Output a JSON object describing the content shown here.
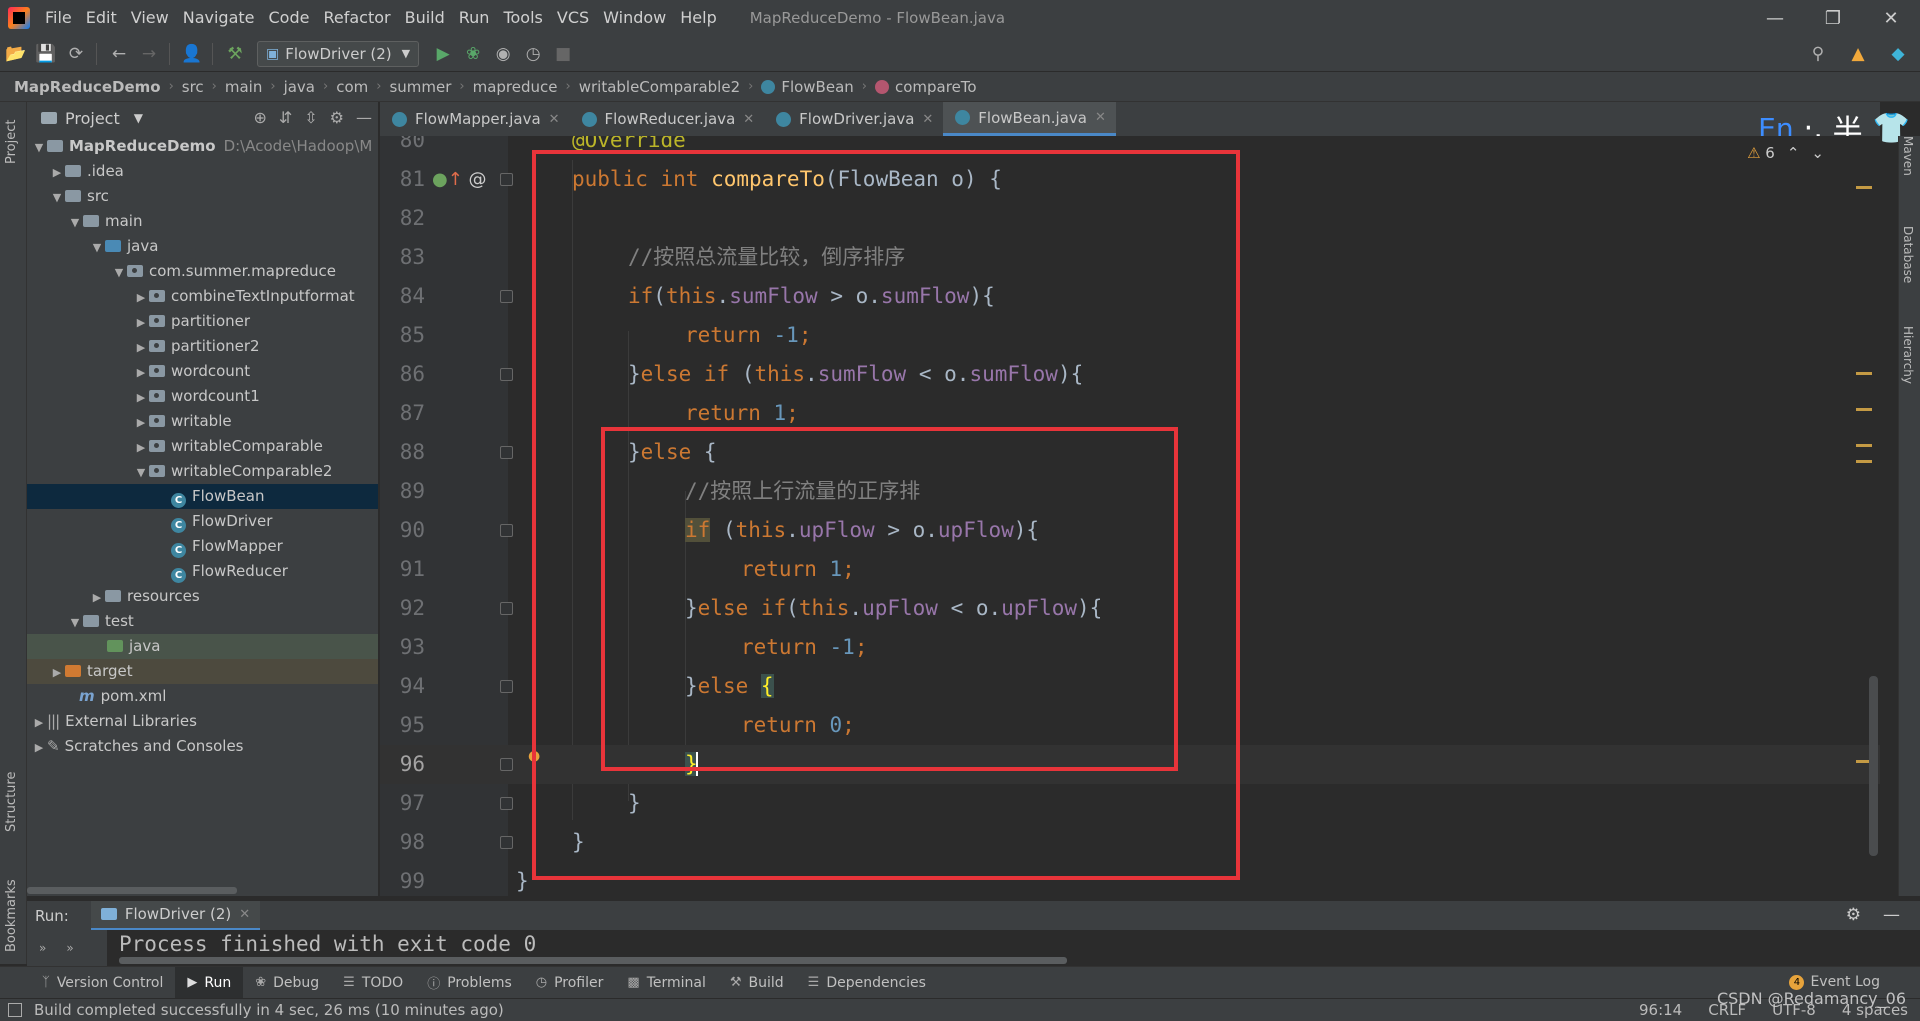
{
  "window": {
    "title": "MapReduceDemo - FlowBean.java",
    "menu": [
      "File",
      "Edit",
      "View",
      "Navigate",
      "Code",
      "Refactor",
      "Build",
      "Run",
      "Tools",
      "VCS",
      "Window",
      "Help"
    ]
  },
  "toolbar": {
    "run_config": "FlowDriver (2)"
  },
  "breadcrumb": [
    "MapReduceDemo",
    "src",
    "main",
    "java",
    "com",
    "summer",
    "mapreduce",
    "writableComparable2",
    "FlowBean",
    "compareTo"
  ],
  "project_panel": {
    "title": "Project",
    "root_name": "MapReduceDemo",
    "root_path": "D:\\Acode\\Hadoop\\M",
    "items": {
      "idea": ".idea",
      "src": "src",
      "main": "main",
      "java": "java",
      "pkg": "com.summer.mapreduce",
      "p1": "combineTextInputformat",
      "p2": "partitioner",
      "p3": "partitioner2",
      "p4": "wordcount",
      "p5": "wordcount1",
      "p6": "writable",
      "p7": "writableComparable",
      "p8": "writableComparable2",
      "c1": "FlowBean",
      "c2": "FlowDriver",
      "c3": "FlowMapper",
      "c4": "FlowReducer",
      "resources": "resources",
      "test": "test",
      "test_java": "java",
      "target": "target",
      "pom": "pom.xml",
      "libs": "External Libraries",
      "scratches": "Scratches and Consoles"
    }
  },
  "tabs": [
    {
      "label": "FlowMapper.java",
      "active": false
    },
    {
      "label": "FlowReducer.java",
      "active": false
    },
    {
      "label": "FlowDriver.java",
      "active": false
    },
    {
      "label": "FlowBean.java",
      "active": true
    }
  ],
  "ime": {
    "lang": "En",
    "punct": "·,",
    "width": "半"
  },
  "editor": {
    "warnings": "6",
    "line_numbers": [
      "80",
      "81",
      "82",
      "83",
      "84",
      "85",
      "86",
      "87",
      "88",
      "89",
      "90",
      "91",
      "92",
      "93",
      "94",
      "95",
      "96",
      "97",
      "98",
      "99"
    ],
    "current_line": "96",
    "code": {
      "l80": "@Override",
      "l81_kw": "public int ",
      "l81_fn": "compareTo",
      "l81_rest": "(FlowBean o) {",
      "l83": "//按照总流量比较，倒序排序",
      "l84_kw1": "if",
      "l84_p1": "(",
      "l84_kw2": "this",
      "l84_p2": ".",
      "l84_f1": "sumFlow",
      "l84_p3": " > o.",
      "l84_f2": "sumFlow",
      "l84_p4": "){",
      "l85_kw": "return ",
      "l85_num": "-1",
      "l85_p": ";",
      "l86_p1": "}",
      "l86_kw1": "else if ",
      "l86_p2": "(",
      "l86_kw2": "this",
      "l86_p3": ".",
      "l86_f1": "sumFlow",
      "l86_p4": " < o.",
      "l86_f2": "sumFlow",
      "l86_p5": "){",
      "l87_kw": "return ",
      "l87_num": "1",
      "l87_p": ";",
      "l88_p1": "}",
      "l88_kw": "else ",
      "l88_p2": "{",
      "l89": "//按照上行流量的正序排",
      "l90_kw1": "if",
      "l90_p1": " (",
      "l90_kw2": "this",
      "l90_p2": ".",
      "l90_f1": "upFlow",
      "l90_p3": " > o.",
      "l90_f2": "upFlow",
      "l90_p4": "){",
      "l91_kw": "return ",
      "l91_num": "1",
      "l91_p": ";",
      "l92_p1": "}",
      "l92_kw1": "else if",
      "l92_p2": "(",
      "l92_kw2": "this",
      "l92_p3": ".",
      "l92_f1": "upFlow",
      "l92_p4": " < o.",
      "l92_f2": "upFlow",
      "l92_p5": "){",
      "l93_kw": "return ",
      "l93_num": "-1",
      "l93_p": ";",
      "l94_p1": "}",
      "l94_kw": "else ",
      "l94_p2": "{",
      "l95_kw": "return ",
      "l95_num": "0",
      "l95_p": ";",
      "l96": "}",
      "l97": "}",
      "l98": "}",
      "l99": "}"
    }
  },
  "run_panel": {
    "label": "Run:",
    "tab": "FlowDriver (2)",
    "output": "Process finished with exit code 0"
  },
  "tool_windows": [
    "Version Control",
    "Run",
    "Debug",
    "TODO",
    "Problems",
    "Profiler",
    "Terminal",
    "Build",
    "Dependencies"
  ],
  "event_log": {
    "label": "Event Log",
    "count": "4"
  },
  "status": {
    "message": "Build completed successfully in 4 sec, 26 ms (10 minutes ago)",
    "position": "96:14",
    "line_sep": "CRLF",
    "encoding": "UTF-8",
    "indent": "4 spaces"
  },
  "watermark": "CSDN @Redamancy_06",
  "side_labels": {
    "project": "Project",
    "structure": "Structure",
    "bookmarks": "Bookmarks",
    "maven": "Maven",
    "database": "Database",
    "hierarchy": "Hierarchy"
  },
  "colors": {
    "keyword": "#cc7832",
    "function": "#ffc66d",
    "field": "#9876aa",
    "number": "#6897bb",
    "comment": "#808080",
    "annotation_box": "#e8343a",
    "accent": "#4a88c7"
  }
}
